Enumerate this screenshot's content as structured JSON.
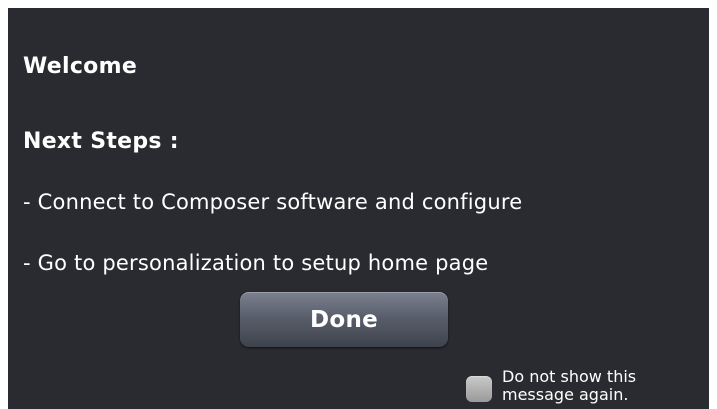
{
  "dialog": {
    "title": "Welcome",
    "subtitle": "Next Steps :",
    "steps": [
      "- Connect to Composer software and configure",
      "- Go to personalization to setup home page"
    ],
    "done_label": "Done",
    "checkbox_label": "Do not show this message again.",
    "checkbox_checked": false
  },
  "colors": {
    "background": "#2a2b30",
    "text": "#ffffff",
    "button": "#5a5f6c",
    "checkbox": "#b0b0b0"
  }
}
